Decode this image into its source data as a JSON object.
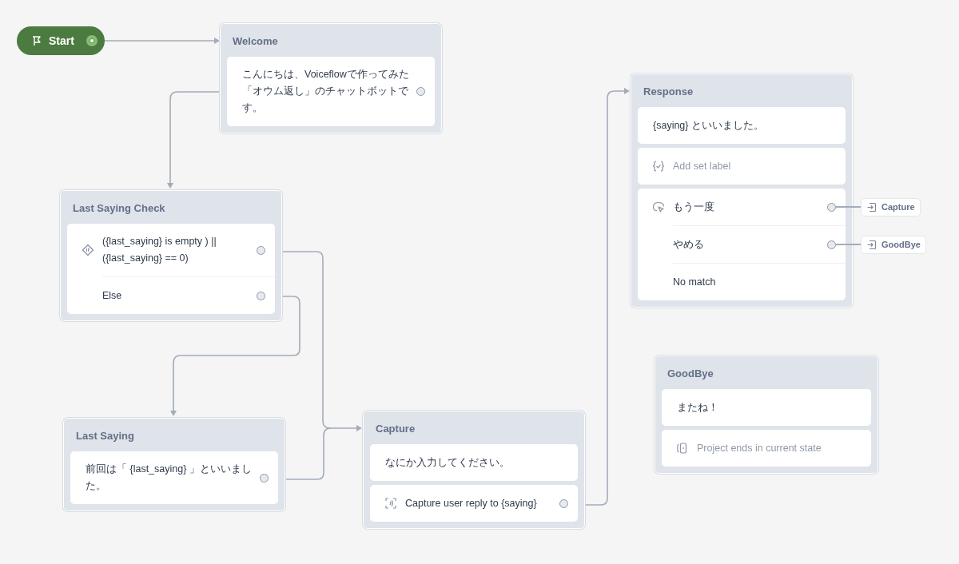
{
  "start": {
    "label": "Start"
  },
  "blocks": [
    {
      "title": "Welcome",
      "steps": [
        {
          "kind": "text",
          "rows": [
            {
              "text": "こんにちは、Voiceflowで作ってみた「オウム返し」のチャットボットです。",
              "port": true
            }
          ]
        }
      ]
    },
    {
      "title": "Last Saying Check",
      "steps": [
        {
          "kind": "condition",
          "rows": [
            {
              "text": "({last_saying} is empty ) || ({last_saying} == 0)",
              "port": true
            },
            {
              "text": "Else",
              "port": true
            }
          ]
        }
      ]
    },
    {
      "title": "Last Saying",
      "steps": [
        {
          "kind": "text",
          "rows": [
            {
              "text": "前回は「 {last_saying} 」といいました。",
              "port": true
            }
          ]
        }
      ]
    },
    {
      "title": "Capture",
      "steps": [
        {
          "kind": "text",
          "rows": [
            {
              "text": "なにか入力してください。",
              "port": false
            }
          ]
        },
        {
          "kind": "capture",
          "rows": [
            {
              "text": "Capture user reply to {saying}",
              "port": true
            }
          ]
        }
      ]
    },
    {
      "title": "Response",
      "steps": [
        {
          "kind": "text",
          "rows": [
            {
              "text": "{saying} といいました。",
              "port": false
            }
          ]
        },
        {
          "kind": "set",
          "rows": [
            {
              "text": "Add set label",
              "port": false
            }
          ]
        },
        {
          "kind": "choice",
          "rows": [
            {
              "text": "もう一度",
              "port": true,
              "link": "Capture"
            },
            {
              "text": "やめる",
              "port": true,
              "link": "GoodBye"
            },
            {
              "text": "No match",
              "port": false
            }
          ]
        }
      ]
    },
    {
      "title": "GoodBye",
      "steps": [
        {
          "kind": "text",
          "rows": [
            {
              "text": "またね！",
              "port": false
            }
          ]
        },
        {
          "kind": "end",
          "rows": [
            {
              "text": "Project ends in current state",
              "port": false
            }
          ]
        }
      ]
    }
  ]
}
